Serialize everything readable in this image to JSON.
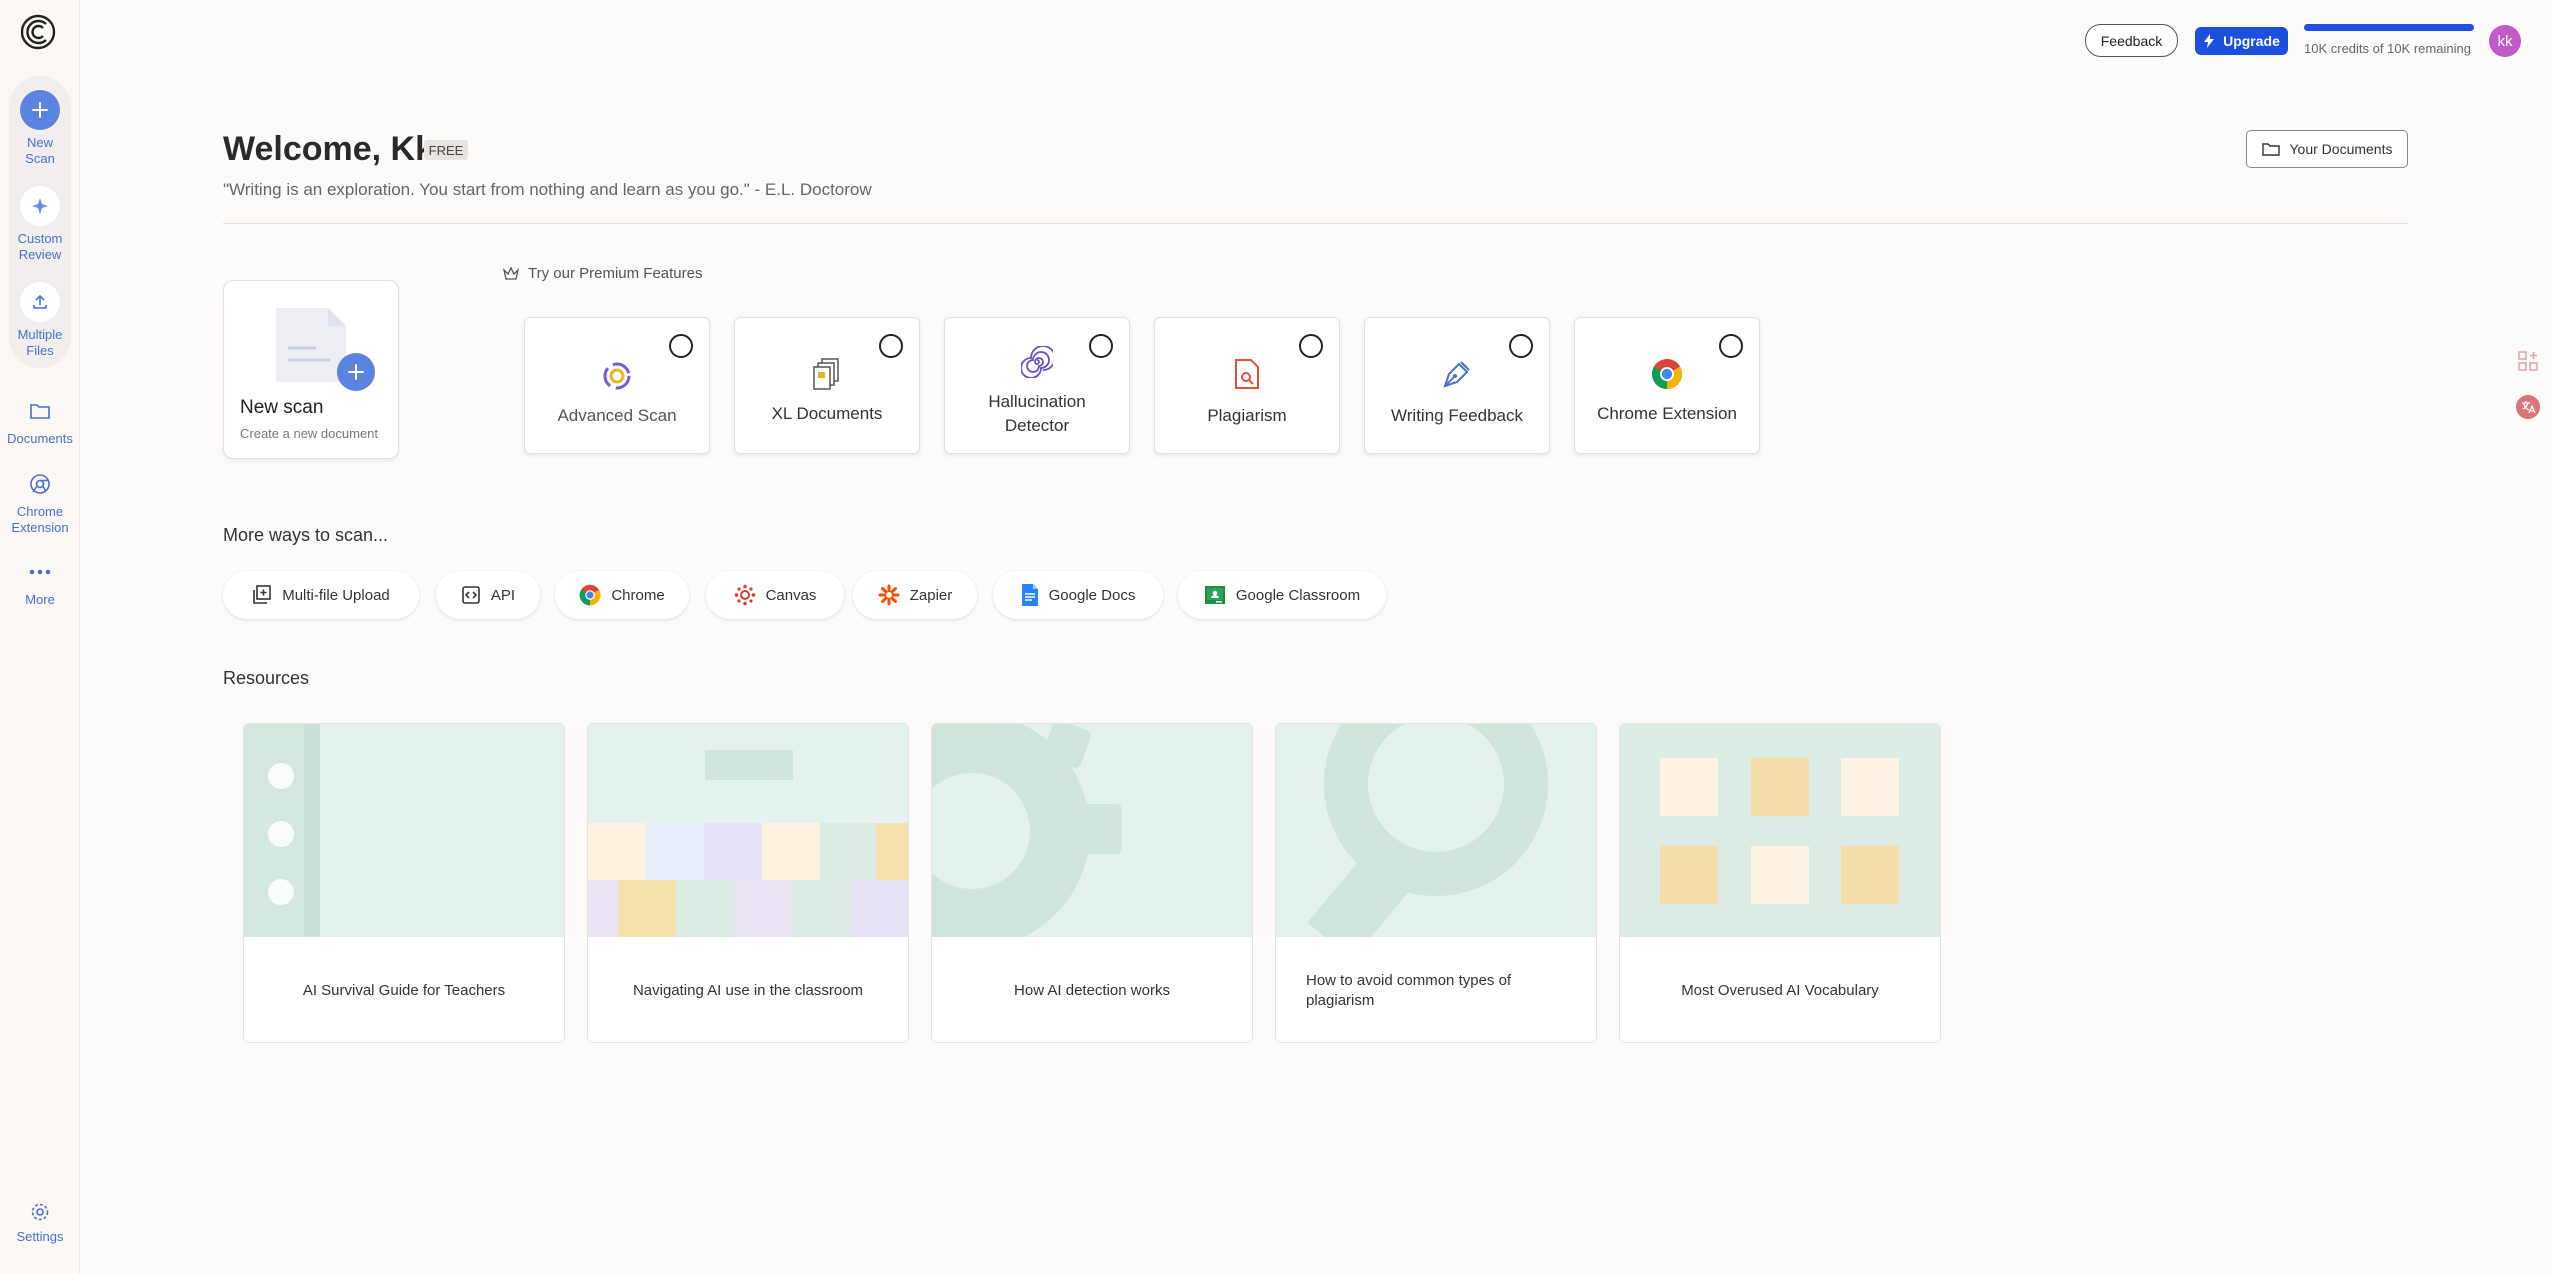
{
  "sidebar": {
    "items": [
      {
        "label": "New\nScan",
        "label1": "New",
        "label2": "Scan",
        "icon": "plus-icon"
      },
      {
        "label1": "Custom",
        "label2": "Review",
        "icon": "sparkle-icon"
      },
      {
        "label1": "Multiple",
        "label2": "Files",
        "icon": "upload-icon"
      },
      {
        "label1": "Documents",
        "icon": "folder-icon"
      },
      {
        "label1": "Chrome",
        "label2": "Extension",
        "icon": "chrome-outline-icon"
      },
      {
        "label1": "More",
        "icon": "more-dots-icon"
      },
      {
        "label1": "Settings",
        "icon": "gear-icon"
      }
    ]
  },
  "topbar": {
    "feedback_label": "Feedback",
    "upgrade_label": "Upgrade",
    "credits_text": "10K credits of 10K remaining",
    "credits_fraction": 1.0,
    "avatar_initials": "kk"
  },
  "header": {
    "welcome": "Welcome, Kk",
    "plan_badge": "FREE",
    "quote": "\"Writing is an exploration. You start from nothing and learn as you go.\" - E.L. Doctorow",
    "your_documents_label": "Your Documents"
  },
  "new_scan": {
    "title": "New scan",
    "subtitle": "Create a new document"
  },
  "premium": {
    "label": "Try our Premium Features",
    "features": [
      {
        "label": "Advanced Scan",
        "icon": "advanced-scan-icon"
      },
      {
        "label": "XL Documents",
        "icon": "stacked-documents-icon"
      },
      {
        "label1": "Hallucination",
        "label2": "Detector",
        "icon": "spiral-icon"
      },
      {
        "label": "Plagiarism",
        "icon": "plagiarism-doc-icon"
      },
      {
        "label": "Writing Feedback",
        "icon": "pen-nib-icon"
      },
      {
        "label": "Chrome Extension",
        "icon": "chrome-icon"
      }
    ]
  },
  "more_ways": {
    "title": "More ways to scan...",
    "items": [
      {
        "label": "Multi-file Upload",
        "icon": "multi-file-icon"
      },
      {
        "label": "API",
        "icon": "code-icon"
      },
      {
        "label": "Chrome",
        "icon": "chrome-icon"
      },
      {
        "label": "Canvas",
        "icon": "canvas-icon"
      },
      {
        "label": "Zapier",
        "icon": "zapier-icon"
      },
      {
        "label": "Google Docs",
        "icon": "google-docs-icon"
      },
      {
        "label": "Google Classroom",
        "icon": "google-classroom-icon"
      }
    ]
  },
  "resources": {
    "title": "Resources",
    "items": [
      {
        "label": "AI Survival Guide for Teachers"
      },
      {
        "label": "Navigating AI use in the classroom"
      },
      {
        "label": "How AI detection works"
      },
      {
        "label": "How to avoid common types of plagiarism"
      },
      {
        "label": "Most Overused AI Vocabulary"
      }
    ]
  },
  "colors": {
    "accent": "#1c4fe0",
    "sidebar_primary": "#5b83df",
    "avatar": "#c05ac9"
  }
}
